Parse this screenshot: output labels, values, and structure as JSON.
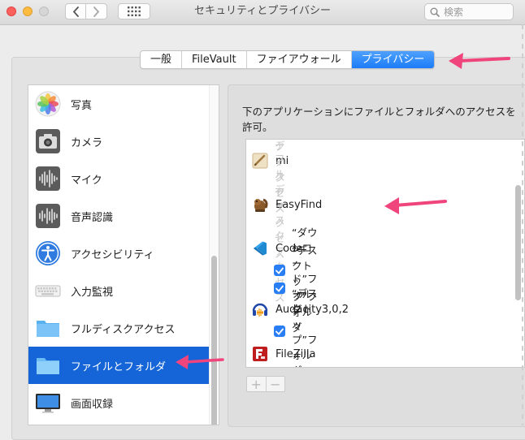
{
  "window": {
    "title": "セキュリティとプライバシー",
    "search_placeholder": "検索"
  },
  "tabs": [
    {
      "label": "一般",
      "active": false
    },
    {
      "label": "FileVault",
      "active": false
    },
    {
      "label": "ファイアウォール",
      "active": false
    },
    {
      "label": "プライバシー",
      "active": true
    }
  ],
  "sidebar": {
    "items": [
      {
        "label": "写真",
        "icon": "photos-icon",
        "selected": false
      },
      {
        "label": "カメラ",
        "icon": "camera-icon",
        "selected": false
      },
      {
        "label": "マイク",
        "icon": "microphone-icon",
        "selected": false
      },
      {
        "label": "音声認識",
        "icon": "speech-recognition-icon",
        "selected": false
      },
      {
        "label": "アクセシビリティ",
        "icon": "accessibility-icon",
        "selected": false
      },
      {
        "label": "入力監視",
        "icon": "keyboard-icon",
        "selected": false
      },
      {
        "label": "フルディスクアクセス",
        "icon": "folder-icon",
        "selected": false
      },
      {
        "label": "ファイルとフォルダ",
        "icon": "folder-icon",
        "selected": true
      },
      {
        "label": "画面収録",
        "icon": "display-icon",
        "selected": false
      }
    ]
  },
  "main": {
    "description": "下のアプリケーションにファイルとフォルダへのアクセスを許可。",
    "list": {
      "header_partial": "フルディスクアクセス",
      "rows": [
        {
          "type": "app",
          "name": "mi",
          "icon": "mi-app-icon"
        },
        {
          "type": "sub",
          "label": "フルディスクアクセス"
        },
        {
          "type": "app",
          "name": "EasyFind",
          "icon": "easyfind-app-icon"
        },
        {
          "type": "sub",
          "label": "フルディスクアクセス"
        },
        {
          "type": "app",
          "name": "Code",
          "icon": "vscode-app-icon"
        },
        {
          "type": "check",
          "label": "“ダウンロード”フォルダ",
          "checked": true
        },
        {
          "type": "check",
          "label": "“デスクトップ”フォルダ",
          "checked": true
        },
        {
          "type": "app",
          "name": "Audacity3,0,2",
          "icon": "audacity-app-icon"
        },
        {
          "type": "check",
          "label": "“デスクトップ”フォルダ",
          "checked": true
        },
        {
          "type": "app",
          "name": "FileZilla",
          "icon": "filezilla-app-icon"
        }
      ]
    },
    "add_label": "+",
    "remove_label": "−"
  },
  "colors": {
    "accent": "#1c7cf8",
    "selection": "#1565d8",
    "annotation_arrow": "#f0447c"
  }
}
